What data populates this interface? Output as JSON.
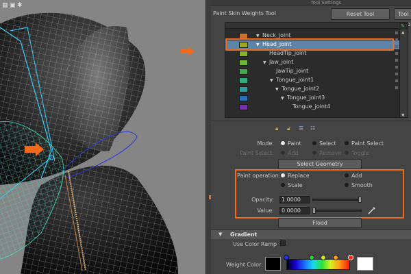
{
  "panel": {
    "window_title": "Tool Settings",
    "tool_name": "Paint Skin Weights Tool",
    "reset_tool_label": "Reset Tool",
    "tool_help_label": "Tool Help"
  },
  "joints": [
    {
      "name": "Neck_joint",
      "color": "#c8702e"
    },
    {
      "name": "Head_joint",
      "color": "#9aa52c",
      "selected": true
    },
    {
      "name": "HeadTip_joint",
      "color": "#86b02e"
    },
    {
      "name": "Jaw_joint",
      "color": "#6fb33a"
    },
    {
      "name": "JawTip_joint",
      "color": "#45a94a"
    },
    {
      "name": "Tongue_joint1",
      "color": "#34ab7c"
    },
    {
      "name": "Tongue_joint2",
      "color": "#2d9f9e"
    },
    {
      "name": "Tongue_joint3",
      "color": "#2d6fb7"
    },
    {
      "name": "Tongue_joint4",
      "color": "#7a2fb5"
    }
  ],
  "mode": {
    "label": "Mode:",
    "options": [
      "Paint",
      "Select",
      "Paint Select"
    ],
    "selected": "Paint"
  },
  "paint_select": {
    "label": "Paint Select:",
    "options": [
      "Add",
      "Remove",
      "Toggle"
    ]
  },
  "select_geometry_label": "Select Geometry",
  "paint_operation": {
    "label": "Paint operation:",
    "options": [
      "Replace",
      "Add",
      "Scale",
      "Smooth"
    ],
    "selected": "Replace"
  },
  "opacity": {
    "label": "Opacity:",
    "value": "1.0000",
    "fraction": 1.0
  },
  "value": {
    "label": "Value:",
    "value": "0.0000",
    "fraction": 0.0
  },
  "flood_label": "Flood",
  "gradient": {
    "section_title": "Gradient",
    "use_color_ramp_label": "Use Color Ramp",
    "weight_color_label": "Weight Color:"
  },
  "colors": {
    "highlight": "#f06a1c",
    "selection": "#5e83a8",
    "wireframe": "#3fe6c0"
  }
}
